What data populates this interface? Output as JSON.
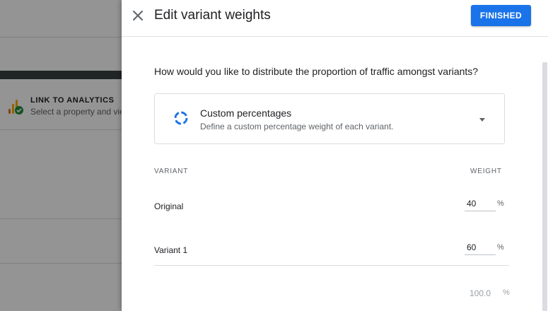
{
  "background": {
    "analytics_title": "LINK TO ANALYTICS",
    "analytics_subtitle": "Select a property and view"
  },
  "panel": {
    "title": "Edit variant weights",
    "finished_label": "FINISHED",
    "question": "How would you like to distribute the proportion of traffic amongst variants?",
    "mode": {
      "title": "Custom percentages",
      "subtitle": "Define a custom percentage weight of each variant."
    },
    "columns": {
      "variant": "VARIANT",
      "weight": "WEIGHT"
    },
    "rows": [
      {
        "name": "Original",
        "weight": "40",
        "unit": "%"
      },
      {
        "name": "Variant 1",
        "weight": "60",
        "unit": "%"
      }
    ],
    "total": {
      "value": "100.0",
      "unit": "%"
    }
  },
  "colors": {
    "accent": "#1a73e8",
    "analytics_check": "#1e8e3e"
  },
  "icons": {
    "close": "close-icon",
    "mode": "custom-percentage-icon",
    "dropdown": "dropdown-caret-icon",
    "analytics": "analytics-icon"
  }
}
